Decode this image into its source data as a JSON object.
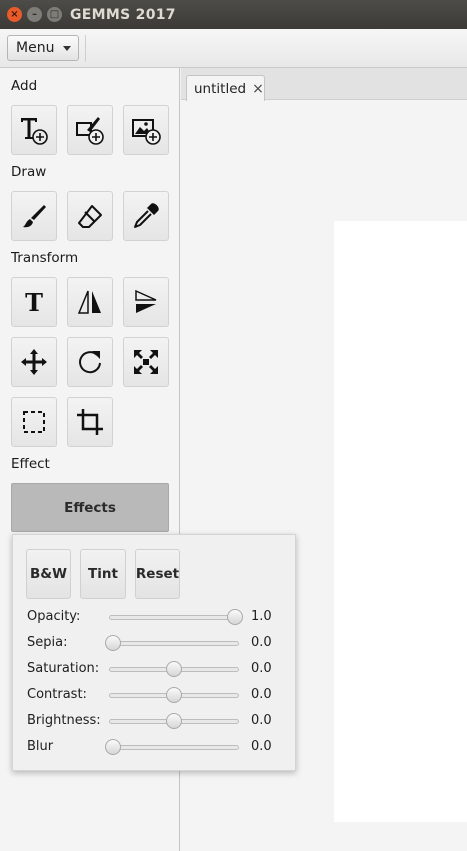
{
  "window": {
    "title": "GEMMS 2017",
    "controls": {
      "close": "×",
      "minimize": "–",
      "maximize": "□"
    }
  },
  "menubar": {
    "menu_label": "Menu"
  },
  "sections": {
    "add": "Add",
    "draw": "Draw",
    "transform": "Transform",
    "effect": "Effect"
  },
  "tools": {
    "add": [
      "add-text-icon",
      "add-shape-icon",
      "add-image-icon"
    ],
    "draw": [
      "brush-icon",
      "eraser-icon",
      "eyedropper-icon"
    ],
    "transform": [
      "text-icon",
      "flip-horizontal-icon",
      "flip-vertical-icon",
      "move-icon",
      "rotate-icon",
      "fullscreen-icon",
      "select-icon",
      "crop-icon"
    ],
    "text_glyph": "T"
  },
  "effects_button": "Effects",
  "effects_panel": {
    "buttons": {
      "bw": "B&W",
      "tint": "Tint",
      "reset": "Reset"
    },
    "sliders": [
      {
        "label": "Opacity:",
        "value": "1.0",
        "level": 1.0
      },
      {
        "label": "Sepia:",
        "value": "0.0",
        "level": 0.0
      },
      {
        "label": "Saturation:",
        "value": "0.0",
        "level": 0.5
      },
      {
        "label": "Contrast:",
        "value": "0.0",
        "level": 0.5
      },
      {
        "label": "Brightness:",
        "value": "0.0",
        "level": 0.5
      },
      {
        "label": "Blur",
        "value": "0.0",
        "level": 0.0
      }
    ]
  },
  "tabs": [
    {
      "label": "untitled",
      "close": "×"
    }
  ],
  "colors": {
    "titlebar": "#3c3b37",
    "close_button": "#e95b2a",
    "effects_button_bg": "#b9b9b9",
    "canvas": "#ffffff"
  }
}
